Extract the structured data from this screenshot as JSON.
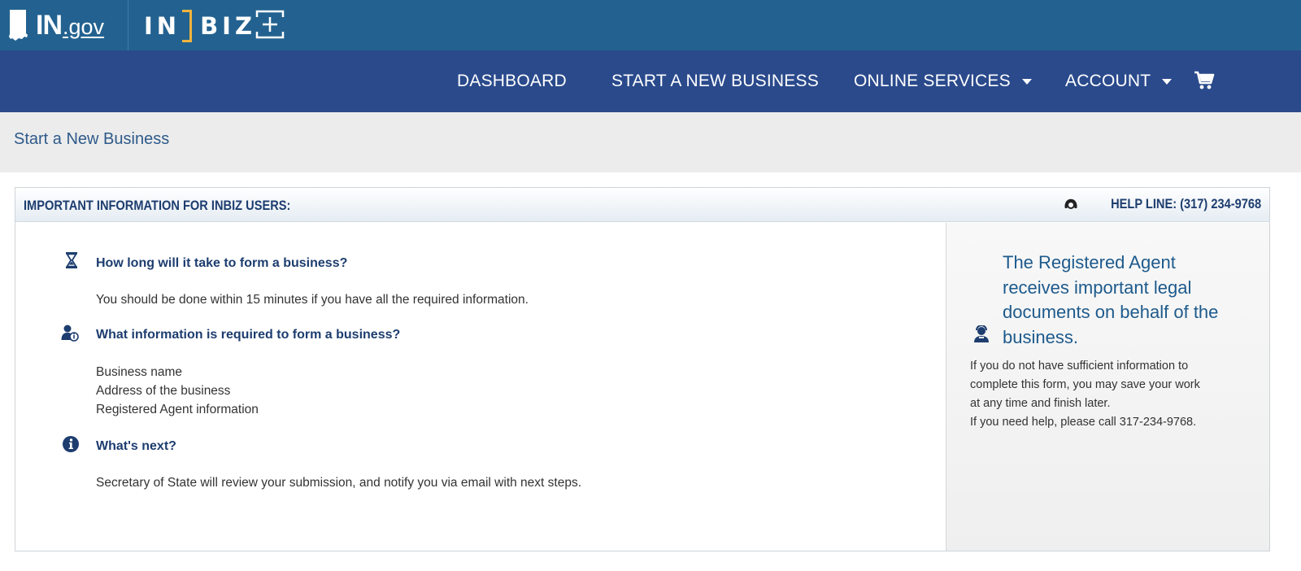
{
  "brand": {
    "ingov_in": "IN",
    "ingov_gov": ".gov",
    "inbiz_in": "IN",
    "inbiz_biz": "BIZ"
  },
  "nav": {
    "items": [
      {
        "label": "DASHBOARD"
      },
      {
        "label": "START A NEW BUSINESS"
      },
      {
        "label": "ONLINE SERVICES"
      },
      {
        "label": "ACCOUNT"
      }
    ]
  },
  "page": {
    "title": "Start a New Business"
  },
  "panel": {
    "header_title": "IMPORTANT INFORMATION FOR INBIZ USERS:",
    "helpline": "HELP LINE: (317) 234-9768",
    "questions": [
      {
        "icon": "hourglass-icon",
        "title": "How long will it take to form a business?",
        "lines": [
          "You should be done within 15 minutes if you have all the required information."
        ]
      },
      {
        "icon": "user-info-icon",
        "title": "What information is required to form a business?",
        "lines": [
          "Business name",
          "Address of the business",
          "Registered Agent information"
        ]
      },
      {
        "icon": "info-icon",
        "title": "What's next?",
        "lines": [
          "Secretary of State will review your submission, and notify you via email with next steps."
        ]
      }
    ],
    "sidebar": {
      "icon": "agent-icon",
      "heading": "The Registered Agent receives important legal documents on behalf of the business.",
      "lines": [
        "If you do not have sufficient information to",
        "complete this form, you may save your work",
        "at any time and finish later.",
        "If you need help, please call 317-234-9768."
      ]
    }
  },
  "colors": {
    "brand_bar": "#236290",
    "nav_bar": "#2a4a8c",
    "accent_gold": "#f2b33d",
    "heading_blue": "#1d3d6f"
  }
}
